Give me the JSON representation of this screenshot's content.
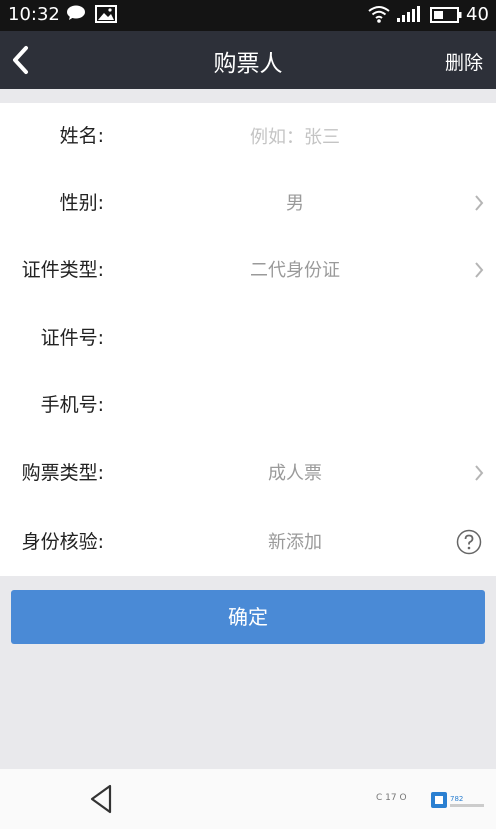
{
  "status_bar": {
    "time": "10:32",
    "battery": "40",
    "icons": [
      "chat-icon",
      "image-icon",
      "wifi-icon",
      "signal-icon",
      "battery-icon"
    ]
  },
  "header": {
    "title": "购票人",
    "delete_label": "删除",
    "back_icon": "chevron-left-icon"
  },
  "form": {
    "name": {
      "label": "姓名:",
      "value": "",
      "placeholder": "例如：张三"
    },
    "gender": {
      "label": "性别:",
      "value": "男"
    },
    "id_type": {
      "label": "证件类型:",
      "value": "二代身份证"
    },
    "id_number": {
      "label": "证件号:",
      "value": ""
    },
    "phone": {
      "label": "手机号:",
      "value": ""
    },
    "ticket_type": {
      "label": "购票类型:",
      "value": "成人票"
    },
    "verification": {
      "label": "身份核验:",
      "value": "新添加"
    }
  },
  "confirm_label": "确定",
  "nav": {
    "back_icon": "triangle-back-icon",
    "watermark_text": "C 17 O",
    "watermark_logo": "7 8 2"
  },
  "colors": {
    "status_bar": "#141414",
    "app_bar": "#2d3039",
    "accent": "#4a8ad6",
    "background": "#e9e9ec"
  }
}
